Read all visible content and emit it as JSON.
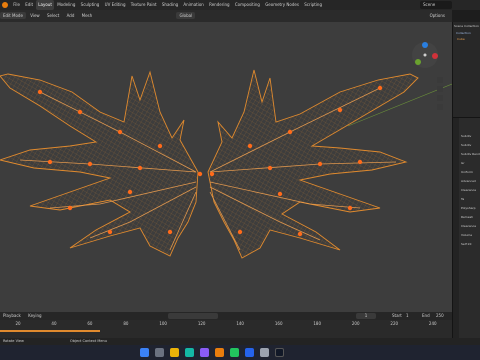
{
  "topbar": {
    "menus": [
      "File",
      "Edit",
      "Render",
      "Window",
      "Help"
    ],
    "workspaces": [
      "Layout",
      "Modeling",
      "Sculpting",
      "UV Editing",
      "Texture Paint",
      "Shading",
      "Animation",
      "Rendering",
      "Compositing",
      "Geometry Nodes",
      "Scripting"
    ],
    "active_workspace": "Layout",
    "scene": "Scene"
  },
  "header": {
    "mode": "Edit Mode",
    "items": [
      "View",
      "Select",
      "Add",
      "Mesh",
      "Vertex",
      "Edge",
      "Face",
      "UV"
    ],
    "transform": "Global",
    "options_label": "Options"
  },
  "viewport": {
    "background": "#3d3d3d",
    "mesh_color": "#e08a2e",
    "accent": "#e87d0d"
  },
  "outliner": {
    "rows": [
      "Scene Collection",
      "Collection",
      "Cube"
    ]
  },
  "properties": {
    "labels": [
      "Subdiv",
      "Subdiv",
      "Subdiv Rend",
      "Gr",
      "Uniform",
      "Advanced",
      "Clearance",
      "Ta",
      "Polysharp",
      "Remesh",
      "Clearance",
      "Volume",
      "Self Int"
    ]
  },
  "timeline": {
    "menus": [
      "Playback",
      "Keying",
      "View",
      "Marker"
    ],
    "ticks": [
      "20",
      "40",
      "60",
      "80",
      "100",
      "120",
      "140",
      "160",
      "180",
      "200",
      "220",
      "240"
    ],
    "frame": "1",
    "start_label": "Start",
    "start": "1",
    "end_label": "End",
    "end": "250"
  },
  "status": {
    "left": "Rotate View",
    "right": "Object Context Menu"
  },
  "taskbar": {
    "icons": [
      "windows-icon",
      "search-icon",
      "files-icon",
      "edge-icon",
      "store-icon",
      "blender-icon",
      "chrome-icon",
      "mail-icon",
      "settings-icon",
      "terminal-icon"
    ]
  }
}
